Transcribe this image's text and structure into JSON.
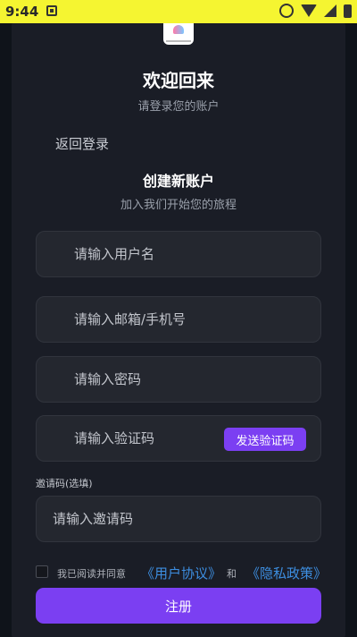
{
  "status_bar": {
    "time": "9:44"
  },
  "header": {
    "title": "欢迎回来",
    "subtitle": "请登录您的账户"
  },
  "back_link": "返回登录",
  "register": {
    "title": "创建新账户",
    "subtitle": "加入我们开始您的旅程",
    "fields": {
      "username_placeholder": "请输入用户名",
      "email_phone_placeholder": "请输入邮箱/手机号",
      "password_placeholder": "请输入密码",
      "code_placeholder": "请输入验证码",
      "invite_placeholder": "请输入邀请码"
    },
    "send_code_label": "发送验证码",
    "invite_label": "邀请码(选填)",
    "agree": {
      "prefix": "我已阅读并同意",
      "user_agreement": "《用户协议》",
      "and": "和",
      "privacy_policy": "《隐私政策》",
      "checked": false
    },
    "submit_label": "注册"
  },
  "colors": {
    "accent": "#7b3ff2",
    "link": "#3d8ee0",
    "status_bar": "#f5f531",
    "background": "#1a1d26"
  },
  "icons": {
    "status_notification": "notification-icon",
    "status_right": [
      "smiley-icon",
      "wifi-icon",
      "signal-icon",
      "battery-icon"
    ],
    "logo": "app-logo"
  }
}
